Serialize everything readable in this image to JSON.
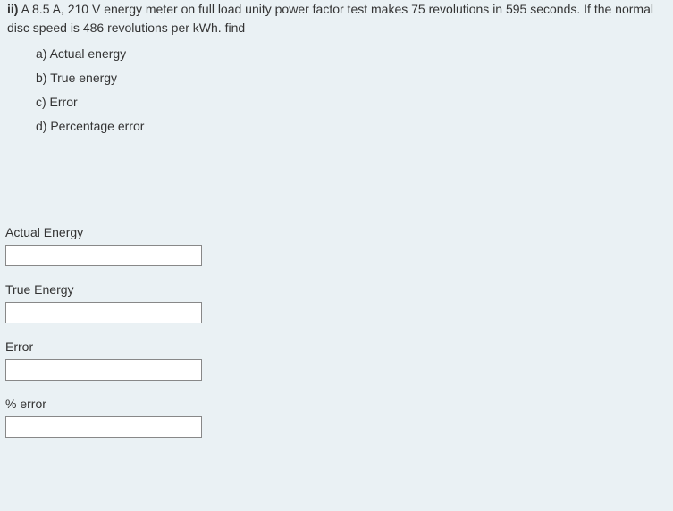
{
  "question": {
    "prefix": "ii)",
    "text": " A 8.5 A, 210 V  energy meter on full load unity power factor test makes 75 revolutions in 595 seconds. If the normal disc speed is 486 revolutions per kWh. find",
    "items": {
      "a": "a) Actual energy",
      "b": " b) True energy",
      "c": "c)  Error",
      "d": "d) Percentage error"
    }
  },
  "answers": {
    "actual_energy_label": "Actual Energy",
    "true_energy_label": "True Energy",
    "error_label": "Error",
    "percent_error_label": "% error",
    "actual_energy_value": "",
    "true_energy_value": "",
    "error_value": "",
    "percent_error_value": ""
  }
}
